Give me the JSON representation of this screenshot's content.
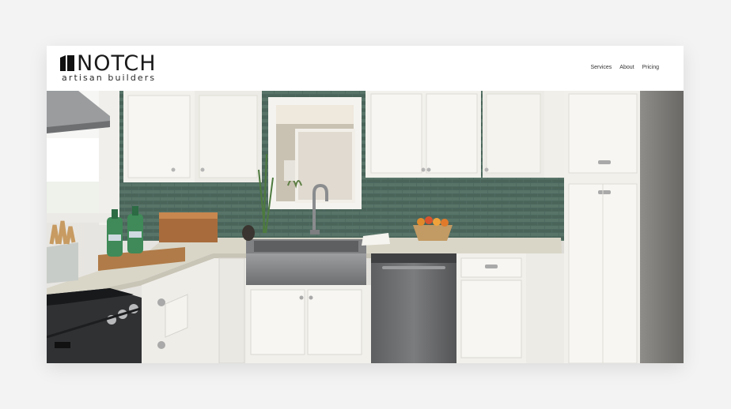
{
  "brand": {
    "name": "NOTCH",
    "tagline": "artisan builders"
  },
  "nav": {
    "items": [
      {
        "label": "Services"
      },
      {
        "label": "About"
      },
      {
        "label": "Pricing"
      }
    ]
  },
  "hero": {
    "image_alt": "White kitchen with green subway tile backsplash, farmhouse sink and stainless dishwasher",
    "colors": {
      "backsplash": "#4f6b62",
      "cabinet": "#f2f1ec",
      "counter": "#d9d6c8",
      "steel": "#8a8c8e"
    }
  }
}
